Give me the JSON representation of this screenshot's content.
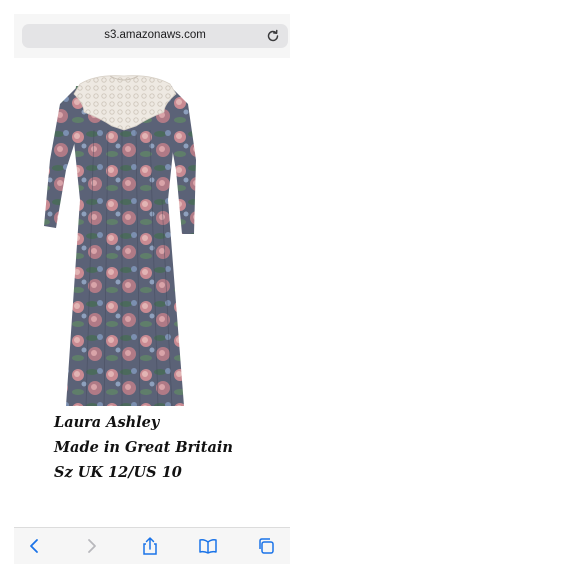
{
  "browser": {
    "url": "s3.amazonaws.com",
    "accent_color": "#1a73e8",
    "toolbar_icons": [
      "back-icon",
      "forward-icon",
      "share-icon",
      "bookmarks-icon",
      "tabs-icon"
    ]
  },
  "content": {
    "caption": {
      "line1": "Laura Ashley",
      "line2": "Made in Great Britain",
      "line3": "Sz UK 12/US 10"
    }
  }
}
